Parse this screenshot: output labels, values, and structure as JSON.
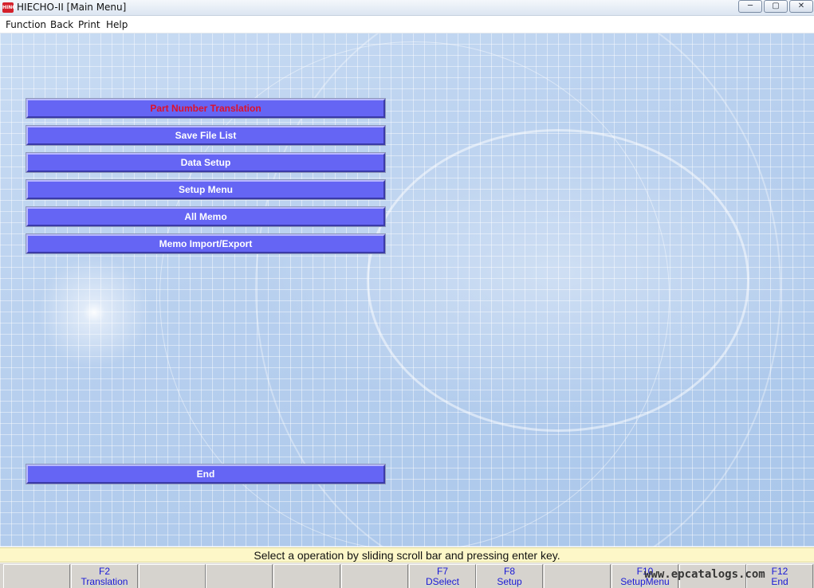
{
  "window": {
    "title": "HIECHO-II [Main Menu]",
    "icon_name": "app-logo-icon",
    "icon_text": "HINO"
  },
  "menubar": {
    "items": [
      {
        "label": "Function"
      },
      {
        "label": "Back"
      },
      {
        "label": "Print"
      },
      {
        "label": "Help"
      }
    ]
  },
  "main_menu": {
    "buttons": [
      {
        "label": "Part Number Translation",
        "selected": true
      },
      {
        "label": "Save File List"
      },
      {
        "label": "Data Setup"
      },
      {
        "label": "Setup Menu"
      },
      {
        "label": "All Memo"
      },
      {
        "label": "Memo Import/Export"
      }
    ],
    "end_button": {
      "label": "End"
    }
  },
  "status": {
    "message": "Select a operation by sliding scroll bar and pressing enter key."
  },
  "function_keys": [
    {
      "key": "",
      "action": ""
    },
    {
      "key": "F2",
      "action": "Translation"
    },
    {
      "key": "",
      "action": ""
    },
    {
      "key": "",
      "action": ""
    },
    {
      "key": "",
      "action": ""
    },
    {
      "key": "",
      "action": ""
    },
    {
      "key": "F7",
      "action": "DSelect"
    },
    {
      "key": "F8",
      "action": "Setup"
    },
    {
      "key": "",
      "action": ""
    },
    {
      "key": "F10",
      "action": "SetupMenu"
    },
    {
      "key": "",
      "action": ""
    },
    {
      "key": "F12",
      "action": "End"
    }
  ],
  "watermark": "www.epcatalogs.com",
  "colors": {
    "button_bg": "#6565f4",
    "selected_text": "#e0102a",
    "fkey_text": "#1a1ad6",
    "status_bg": "#fdf7c8"
  }
}
